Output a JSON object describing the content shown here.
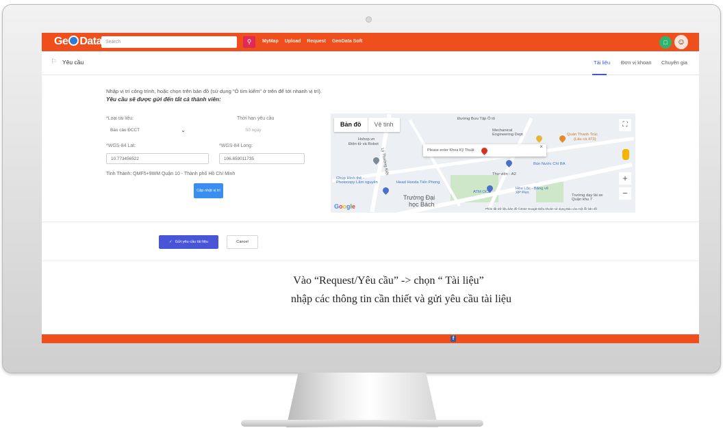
{
  "header": {
    "logo_pre": "Ge",
    "logo_post": "Data",
    "search_placeholder": "Search",
    "search_icon": "search-icon",
    "menu": [
      "MyMap",
      "Upload",
      "Request",
      "GeoData Soft"
    ],
    "chat_icon": "chat-icon",
    "avatar_icon": "user-avatar"
  },
  "page": {
    "title": "Yêu cầu",
    "tabs": [
      {
        "label": "Tài liệu",
        "active": true
      },
      {
        "label": "Đơn vị khoan",
        "active": false
      },
      {
        "label": "Chuyên gia",
        "active": false
      }
    ]
  },
  "form": {
    "intro": "Nhập vị trí công trình, hoặc chọn trên bản đồ (sử dụng \"Ô tìm kiếm\" ở trên để tới nhanh vị trí).",
    "intro_bold": "Yêu cầu sẽ được gửi đến tất cả thành viên:",
    "doc_type_label": "*Loại tài liệu:",
    "doc_type_value": "Báo cáo ĐCCT",
    "deadline_label": "Thời hạn yêu cầu",
    "deadline_placeholder": "Số ngày",
    "lat_label": "*WGS-84 Lat:",
    "lat_value": "10.773456522",
    "long_label": "*WGS-84 Long:",
    "long_value": "106.659011735",
    "province": "Tỉnh Thành: QMF5+9WM Quận 10 - Thành phố Hồ Chí Minh",
    "update_button": "Cập nhật vị trí"
  },
  "map": {
    "tab_map": "Bản đồ",
    "tab_satellite": "Vệ tinh",
    "popup_text": "Please enter Khoa Kỹ Thuật",
    "labels": {
      "hshop": "Hshop.vn",
      "robot": "Điện tử và Robot",
      "street": "Lý Thường Kiệt",
      "mech": "Mechanical Engineering Dept",
      "thanh_truc": "Quán Thanh Trúc",
      "thanh_truc_sub": "(Lâu cá 473)",
      "bun_nuoc": "Bún Nước Chí BA",
      "thu_vien": "Thư viện - A2",
      "chup_hinh": "Chụp Hình thẻ - Photocopy Lâm nguyên",
      "honda": "Head Honda Tiến Phong",
      "atm": "ATM OCB",
      "hoa_loc": "Hòa Lộc - Bảng vẽ XP Pen",
      "truong_day": "Trường dạy lái xe Quận khu 7",
      "truong_dai": "Trường Đại",
      "hoc_bach": "học Bách",
      "road_top": "Đường Bưu Tập Ô tô"
    },
    "attribution": "Phím tắt   Dữ liệu bản đồ ©2022 Google   Điều khoản sử dụng   Báo cáo một lỗi bản đồ",
    "google": [
      "G",
      "o",
      "o",
      "g",
      "l",
      "e"
    ],
    "fullscreen_icon": "fullscreen-icon",
    "zoom_in": "+",
    "zoom_out": "−"
  },
  "actions": {
    "submit": "Gửi yêu cầu tài liệu",
    "cancel": "Cancel"
  },
  "caption": {
    "line1": "Vào “Request/Yêu cầu” -> chọn “ Tài liệu”",
    "line2": "nhập các thông tin cần thiết và gửi yêu cầu tài liệu"
  },
  "colors": {
    "brand": "#ee4f1c",
    "primary_button": "#4755d6",
    "update_button": "#3a8ef0",
    "tab_active": "#3b5bd6"
  }
}
